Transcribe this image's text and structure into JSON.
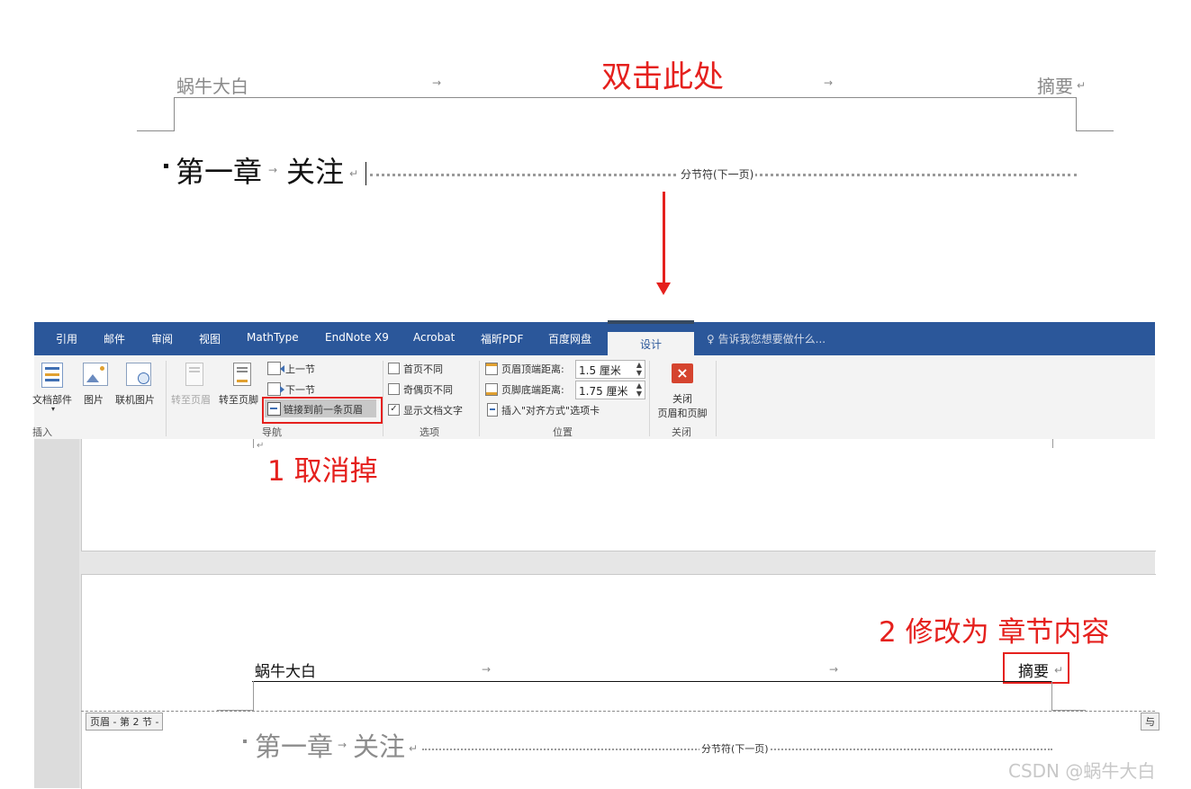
{
  "top_doc": {
    "header_left": "蜗牛大白",
    "header_right": "摘要",
    "annotation_double_click": "双击此处",
    "heading_number": "第一章",
    "heading_title": "关注",
    "section_break": "分节符(下一页)",
    "tab_arrow": "→",
    "para_mark": "↵"
  },
  "ribbon_tabs": [
    "引用",
    "邮件",
    "审阅",
    "视图",
    "MathType",
    "EndNote X9",
    "Acrobat",
    "福昕PDF",
    "百度网盘"
  ],
  "active_tab": "设计",
  "tell_me": "告诉我您想要做什么...",
  "ribbon": {
    "insert_group": {
      "doc_parts": "文档部件",
      "picture": "图片",
      "online_picture": "联机图片",
      "label": "插入"
    },
    "nav_group": {
      "goto_header": "转至页眉",
      "goto_footer": "转至页脚",
      "prev_section": "上一节",
      "next_section": "下一节",
      "link_previous": "链接到前一条页眉",
      "label": "导航"
    },
    "options_group": {
      "diff_first": "首页不同",
      "diff_odd_even": "奇偶页不同",
      "show_doc_text": "显示文档文字",
      "show_doc_text_checked": "✓",
      "label": "选项"
    },
    "position_group": {
      "header_top": "页眉顶端距离:",
      "header_top_value": "1.5 厘米",
      "footer_bottom": "页脚底端距离:",
      "footer_bottom_value": "1.75 厘米",
      "insert_align_tab": "插入\"对齐方式\"选项卡",
      "label": "位置"
    },
    "close_group": {
      "close_btn": "关闭\n页眉和页脚",
      "close_line1": "关闭",
      "close_line2": "页眉和页脚",
      "label": "关闭"
    }
  },
  "lower_doc": {
    "annotation_step1": "1 取消掉",
    "annotation_step2": "2 修改为 章节内容",
    "header_left": "蜗牛大白",
    "header_right": "摘要",
    "header_tag": "页眉 - 第 2 节 -",
    "right_tag": "与",
    "heading_number": "第一章",
    "heading_title": "关注",
    "section_break": "分节符(下一页)"
  },
  "watermark": "CSDN @蜗牛大白",
  "colors": {
    "annotation_red": "#e5201d",
    "ribbon_blue": "#2b579a",
    "ribbon_bg": "#f3f3f3",
    "close_red": "#d5442f"
  }
}
